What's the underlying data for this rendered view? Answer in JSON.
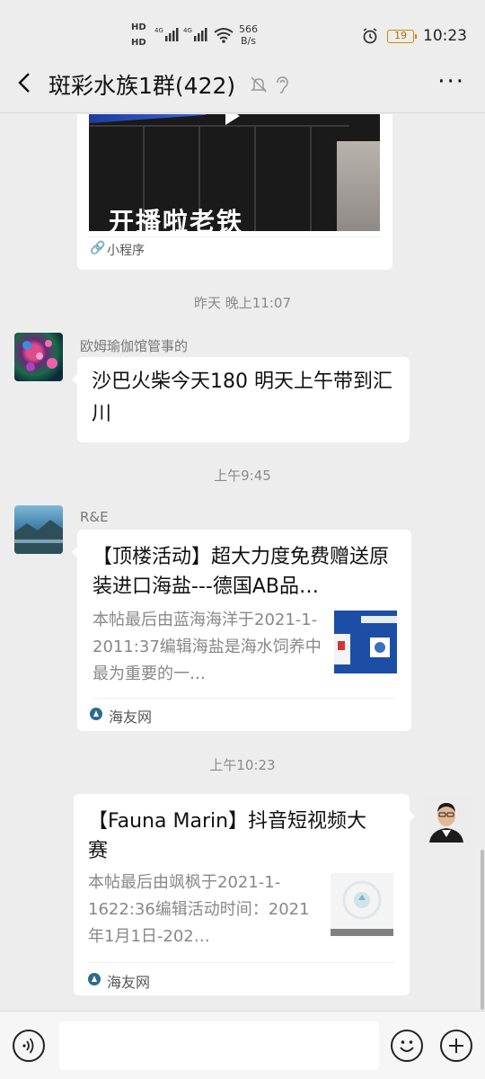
{
  "status_bar": {
    "hd1": "HD",
    "hd2": "HD",
    "net1": "4G",
    "net2": "4G",
    "speed_value": "566",
    "speed_unit": "B/s",
    "battery": "19",
    "time": "10:23",
    "icons": [
      "alarm-icon",
      "wifi-icon",
      "signal-icon",
      "battery-icon"
    ]
  },
  "header": {
    "title": "斑彩水族1群(422)",
    "more": "···",
    "icons": [
      "back-icon",
      "mute-icon",
      "ear-icon",
      "more-icon"
    ]
  },
  "messages": {
    "mini_program": {
      "caption": "开播啦老铁",
      "source_label": "小程序"
    },
    "ts1": "昨天 晚上11:07",
    "msg1": {
      "sender": "欧姆瑜伽馆管事的",
      "text": "沙巴火柴今天180 明天上午带到汇川"
    },
    "ts2": "上午9:45",
    "msg2": {
      "sender": "R&E",
      "title": "【顶楼活动】超大力度免费赠送原装进口海盐---德国AB品…",
      "desc": "本帖最后由蓝海海洋于2021-1-2011:37编辑海盐是海水饲养中最为重要的一…",
      "site": "海友网"
    },
    "ts3": "上午10:23",
    "msg3": {
      "title": "【Fauna Marin】抖音短视频大赛",
      "desc": "本帖最后由飒枫于2021-1-1622:36编辑活动时间：2021年1月1日-202…",
      "site": "海友网"
    }
  },
  "input_bar": {
    "icons": [
      "voice-icon",
      "emoji-icon",
      "plus-icon"
    ]
  },
  "colors": {
    "background": "#ededed",
    "bubble": "#ffffff",
    "meta_text": "#8a8a8a"
  }
}
